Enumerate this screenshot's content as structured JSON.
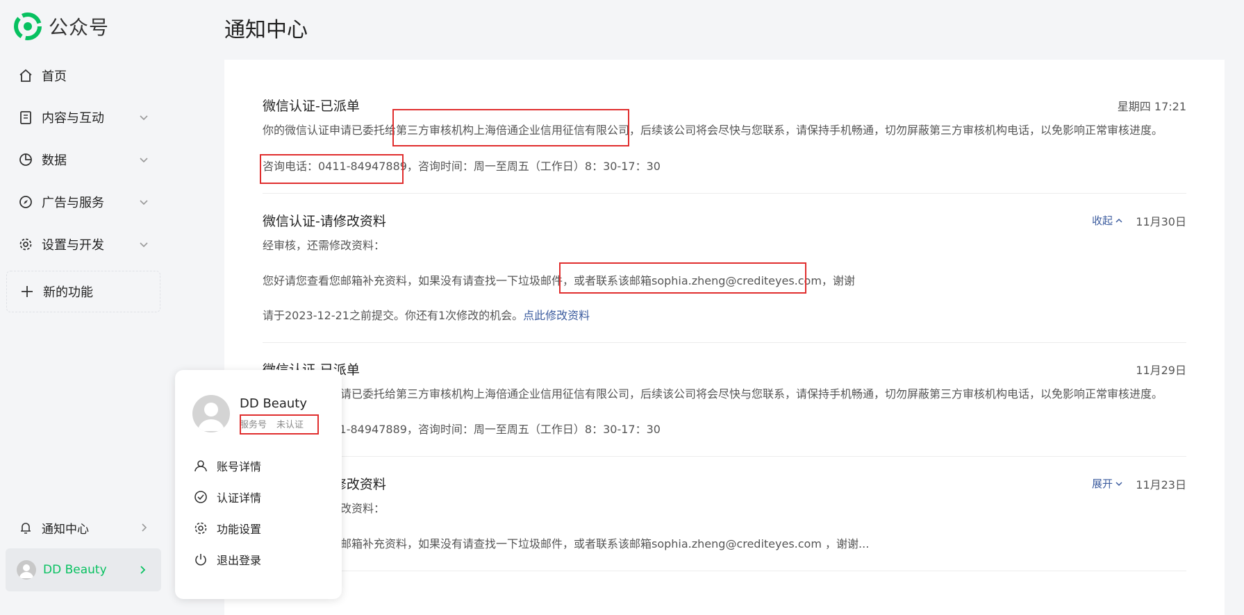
{
  "brand": {
    "name": "公众号",
    "accent": "#07c160"
  },
  "sidebar": {
    "items": [
      {
        "label": "首页",
        "icon": "home-icon"
      },
      {
        "label": "内容与互动",
        "icon": "document-icon"
      },
      {
        "label": "数据",
        "icon": "pie-chart-icon"
      },
      {
        "label": "广告与服务",
        "icon": "compass-icon"
      },
      {
        "label": "设置与开发",
        "icon": "gear-icon"
      }
    ],
    "new_feature": "新的功能",
    "notification_center": "通知中心",
    "account_name": "DD Beauty"
  },
  "main": {
    "title": "通知中心",
    "notices": [
      {
        "title": "微信认证-已派单",
        "date": "星期四 17:21",
        "line1": "你的微信认证申请已委托给第三方审核机构上海倍通企业信用征信有限公司，后续该公司将会尽快与您联系，请保持手机畅通，切勿屏蔽第三方审核机构电话，以免影响正常审核进度。",
        "line2": "咨询电话：0411-84947889，咨询时间：周一至周五（工作日）8：30-17：30"
      },
      {
        "title": "微信认证-请修改资料",
        "date": "11月30日",
        "toggle": "收起",
        "line1": "经审核，还需修改资料：",
        "line2": "您好请您查看您邮箱补充资料，如果没有请查找一下垃圾邮件，或者联系该邮箱sophia.zheng@crediteyes.com，谢谢",
        "line3_prefix": "请于2023-12-21之前提交。你还有1次修改的机会。",
        "line3_link": "点此修改资料"
      },
      {
        "title": "微信认证-已派单",
        "date": "11月29日",
        "line1": "你的微信认证申请已委托给第三方审核机构上海倍通企业信用征信有限公司，后续该公司将会尽快与您联系，请保持手机畅通，切勿屏蔽第三方审核机构电话，以免影响正常审核进度。",
        "line2": "咨询电话：0411-84947889，咨询时间：周一至周五（工作日）8：30-17：30"
      },
      {
        "title": "微信认证-请修改资料",
        "date": "11月23日",
        "toggle": "展开",
        "line1": "经审核，还需修改资料：",
        "line2": "您好请您查看您邮箱补充资料，如果没有请查找一下垃圾邮件，或者联系该邮箱sophia.zheng@crediteyes.com ，谢谢..."
      }
    ]
  },
  "popover": {
    "name": "DD Beauty",
    "tag_type": "服务号",
    "tag_status": "未认证",
    "menu": [
      {
        "label": "账号详情",
        "icon": "user-icon"
      },
      {
        "label": "认证详情",
        "icon": "check-circle-icon"
      },
      {
        "label": "功能设置",
        "icon": "gear-icon"
      },
      {
        "label": "退出登录",
        "icon": "power-icon"
      }
    ]
  }
}
